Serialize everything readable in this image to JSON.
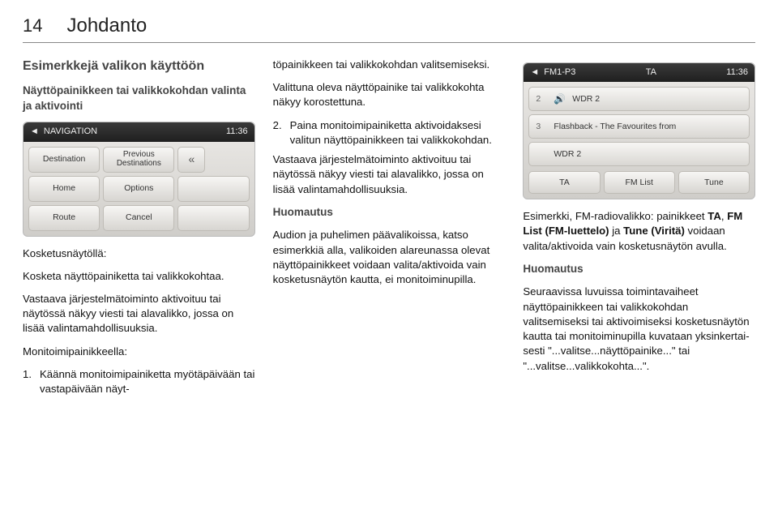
{
  "page": {
    "number": "14",
    "title": "Johdanto"
  },
  "col1": {
    "h2": "Esimerkkejä valikon käyttöön",
    "h3": "Näyttöpainikkeen tai valikkokohdan valinta ja aktivointi",
    "touchHeading": "Kosketusnäytöllä:",
    "touchLine": "Kosketa näyttöpainiketta tai valikko­kohtaa.",
    "touchPara": "Vastaava järjestelmätoiminto aktivoi­tuu tai näytössä näkyy viesti tai ala­valikko, jossa on lisää valintamahdol­lisuuksia.",
    "controllerHeading": "Monitoimipainikkeella:",
    "controllerItemNum": "1.",
    "controllerItemText": "Käännä monitoimipainiketta myö­täpäivään tai vastapäivään näyt-"
  },
  "navScreen": {
    "title": "NAVIGATION",
    "clock": "11:36",
    "b1": "Destination",
    "b2": "Previous Destinations",
    "b3": "«",
    "b4": "Home",
    "b5": "Options",
    "b6": "",
    "b7": "Route",
    "b8": "Cancel",
    "b9": ""
  },
  "col2": {
    "cont1": "töpainikkeen tai valikkokohdan valitsemiseksi.",
    "cont2": "Valittuna oleva näyttöpainike tai valikkokohta näkyy korostettuna.",
    "item2Num": "2.",
    "item2Text": "Paina monitoimipainiketta aktivoi­daksesi valitun näyttöpainikkeen tai valikkokohdan.",
    "item2Para": "Vastaava järjestelmätoiminto ak­tivoituu tai näytössä näkyy viesti tai alavalikko, jossa on lisää valin­tamahdollisuuksia.",
    "noteHeading": "Huomautus",
    "notePara": "Audion ja puhelimen päävalikoissa, katso esimerkkiä alla, valikoiden ala­reunassa olevat näyttöpainikkeet voidaan valita/aktivoida vain koske­tusnäytön kautta, ei monitoiminu­pilla."
  },
  "fmScreen": {
    "leftLabel": "FM1-P3",
    "taLabel": "TA",
    "clock": "11:36",
    "row1n": "2",
    "row1": "WDR 2",
    "row2n": "3",
    "row2": "Flashback - The Favourites from",
    "row3n": "",
    "row3": "WDR 2",
    "btn1": "TA",
    "btn2": "FM List",
    "btn3": "Tune"
  },
  "col3": {
    "p1a": "Esimerkki, FM-radiovalikko: painik­keet ",
    "p1b": "TA",
    "p1c": ", ",
    "p1d": "FM List (FM-luettelo)",
    "p1e": " ja ",
    "p1f": "Tune (Viritä)",
    "p1g": " voidaan valita/aktivoida vain kosketusnäytön avulla.",
    "noteHeading": "Huomautus",
    "notePara": "Seuraavissa luvuissa toimintavai­heet näyttöpainikkeen tai valikko­kohdan valitsemiseksi tai aktivoimi­seksi kosketusnäytön kautta tai mo­nitoiminupilla kuvataan yksinkertai­sesti \"...valitse...näyttöpainike...\" tai \"...valitse...valikkokohta...\"."
  }
}
